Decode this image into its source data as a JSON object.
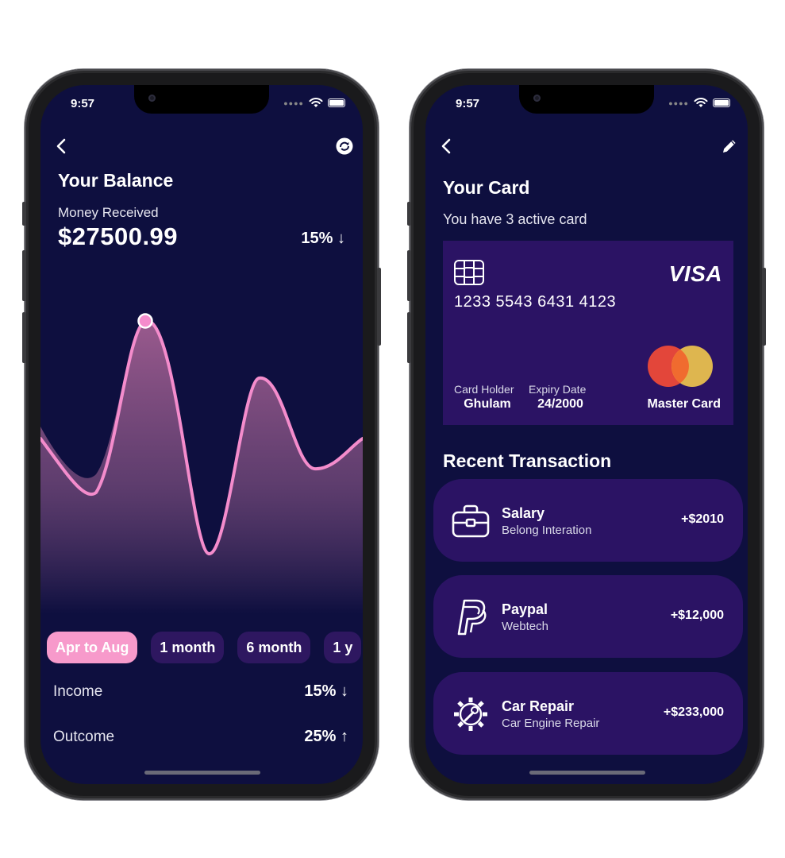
{
  "status": {
    "time": "9:57"
  },
  "balance_screen": {
    "title": "Your Balance",
    "money_label": "Money Received",
    "amount": "$27500.99",
    "change": "15% ↓",
    "tabs": [
      {
        "label": "Apr to Aug",
        "active": true
      },
      {
        "label": "1 month",
        "active": false
      },
      {
        "label": "6 month",
        "active": false
      },
      {
        "label": "1 y",
        "active": false
      }
    ],
    "stats": [
      {
        "label": "Income",
        "value": "15% ↓"
      },
      {
        "label": "Outcome",
        "value": "25% ↑"
      }
    ]
  },
  "card_screen": {
    "title": "Your Card",
    "subtitle": "You have 3 active card",
    "card": {
      "brand": "VISA",
      "number": "1233 5543 6431 4123",
      "holder_label": "Card Holder",
      "holder_name": "Ghulam",
      "expiry_label": "Expiry Date",
      "expiry_value": "24/2000",
      "network_label": "Master Card"
    },
    "recent_title": "Recent Transaction",
    "transactions": [
      {
        "name": "Salary",
        "subtitle": "Belong Interation",
        "amount": "+$2010",
        "icon": "briefcase-icon"
      },
      {
        "name": "Paypal",
        "subtitle": "Webtech",
        "amount": "+$12,000",
        "icon": "paypal-icon"
      },
      {
        "name": "Car Repair",
        "subtitle": "Car Engine Repair",
        "amount": "+$233,000",
        "icon": "gear-wrench-icon"
      }
    ]
  },
  "colors": {
    "background": "#0e0f3f",
    "accent_pink": "#f79acb",
    "card_purple": "#2b1364",
    "pill_purple": "#2e1760"
  }
}
